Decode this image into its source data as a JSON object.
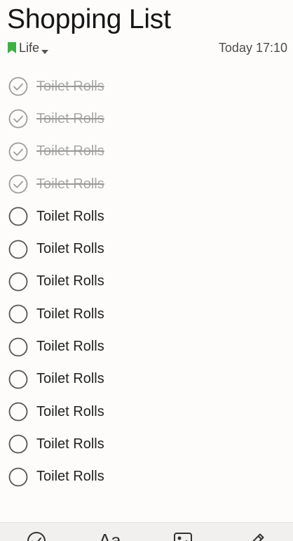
{
  "note": {
    "title": "Shopping List",
    "notebook": {
      "label": "Life",
      "icon": "bookmark-icon",
      "icon_color": "#3cb043"
    },
    "timestamp": "Today 17:10"
  },
  "items": [
    {
      "text": "Toilet Rolls",
      "checked": true
    },
    {
      "text": "Toilet Rolls",
      "checked": true
    },
    {
      "text": "Toilet Rolls",
      "checked": true
    },
    {
      "text": "Toilet Rolls",
      "checked": true
    },
    {
      "text": "Toilet Rolls",
      "checked": false
    },
    {
      "text": "Toilet Rolls",
      "checked": false
    },
    {
      "text": "Toilet Rolls",
      "checked": false
    },
    {
      "text": "Toilet Rolls",
      "checked": false
    },
    {
      "text": "Toilet Rolls",
      "checked": false
    },
    {
      "text": "Toilet Rolls",
      "checked": false
    },
    {
      "text": "Toilet Rolls",
      "checked": false
    },
    {
      "text": "Toilet Rolls",
      "checked": false
    },
    {
      "text": "Toilet Rolls",
      "checked": false
    }
  ],
  "toolbar": {
    "items": [
      {
        "name": "checklist-tool",
        "icon": "check-circle-icon"
      },
      {
        "name": "text-format-tool",
        "icon": "text-format-icon",
        "label": "Aa"
      },
      {
        "name": "image-tool",
        "icon": "image-icon"
      },
      {
        "name": "draw-tool",
        "icon": "pencil-icon"
      }
    ]
  },
  "colors": {
    "background": "#fdfcfb",
    "accent_green": "#3cb043",
    "checked_text": "#a9a9a9",
    "text": "#222222"
  }
}
